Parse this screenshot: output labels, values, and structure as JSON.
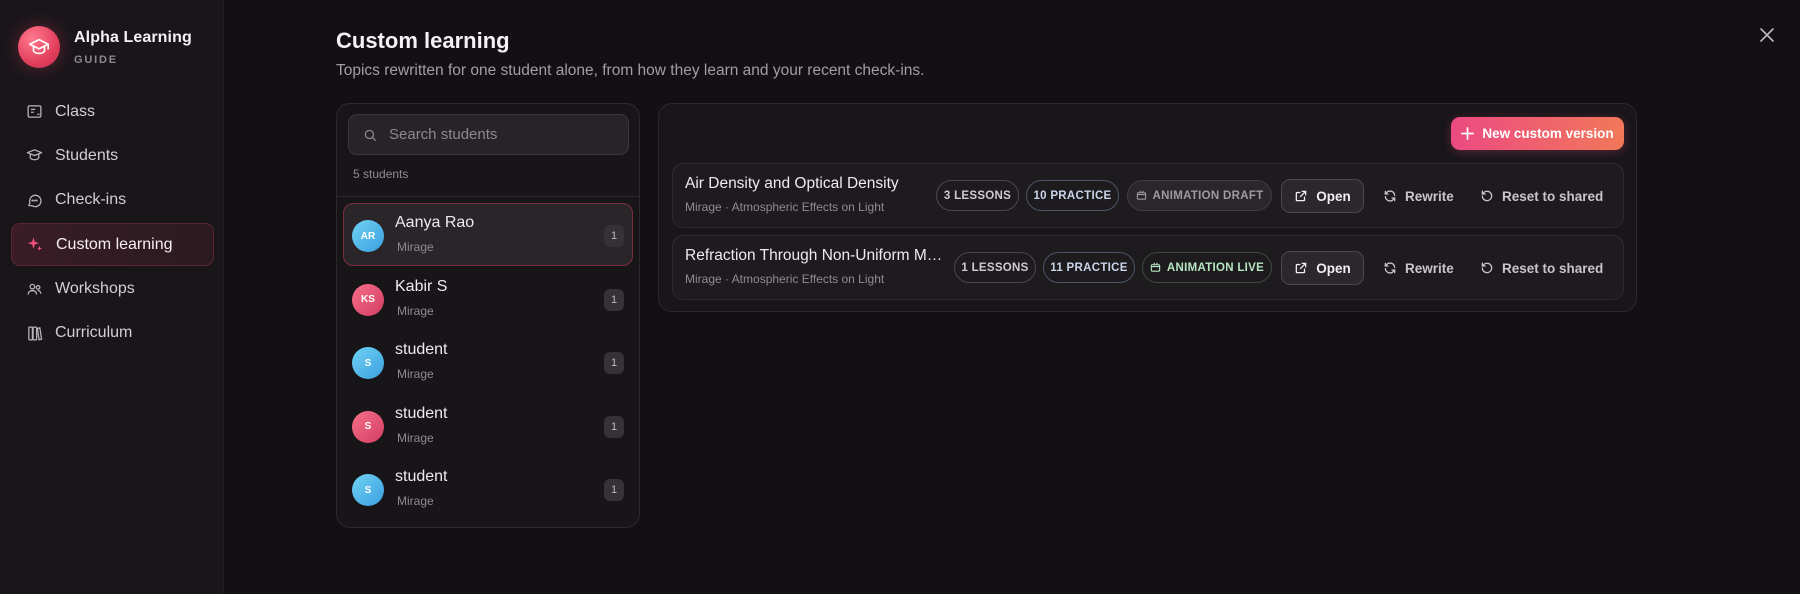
{
  "brand": {
    "title": "Alpha Learning",
    "subtitle": "GUIDE"
  },
  "nav": [
    {
      "label": "Class",
      "icon": "class-icon",
      "active": false
    },
    {
      "label": "Students",
      "icon": "students-icon",
      "active": false
    },
    {
      "label": "Check-ins",
      "icon": "chat-icon",
      "active": false
    },
    {
      "label": "Custom learning",
      "icon": "sparkle-icon",
      "active": true
    },
    {
      "label": "Workshops",
      "icon": "people-icon",
      "active": false
    },
    {
      "label": "Curriculum",
      "icon": "books-icon",
      "active": false
    }
  ],
  "header": {
    "title": "Custom learning",
    "subtitle": "Topics rewritten for one student alone, from how they learn and your recent check-ins."
  },
  "search": {
    "placeholder": "Search students"
  },
  "students_count": "5 students",
  "students": [
    {
      "initials": "AR",
      "name": "Aanya Rao",
      "group": "Mirage",
      "count": "1",
      "color": "blue",
      "active": true
    },
    {
      "initials": "KS",
      "name": "Kabir S",
      "group": "Mirage",
      "count": "1",
      "color": "pink",
      "active": false
    },
    {
      "initials": "S",
      "name": "student",
      "group": "Mirage",
      "count": "1",
      "color": "blue",
      "active": false
    },
    {
      "initials": "S",
      "name": "student",
      "group": "Mirage",
      "count": "1",
      "color": "pink",
      "active": false
    },
    {
      "initials": "S",
      "name": "student",
      "group": "Mirage",
      "count": "1",
      "color": "blue",
      "active": false
    }
  ],
  "new_button": "New custom version",
  "topics": [
    {
      "title": "Air Density and Optical Density",
      "subtitle": "Mirage · Atmospheric Effects on Light",
      "lessons": "3 LESSONS",
      "practice": "10 PRACTICE",
      "animation": "ANIMATION DRAFT",
      "open": "Open",
      "rewrite": "Rewrite",
      "reset": "Reset to shared"
    },
    {
      "title": "Refraction Through Non-Uniform Media",
      "subtitle": "Mirage · Atmospheric Effects on Light",
      "lessons": "1 LESSONS",
      "practice": "11 PRACTICE",
      "animation": "ANIMATION LIVE",
      "open": "Open",
      "rewrite": "Rewrite",
      "reset": "Reset to shared"
    }
  ],
  "colors": {
    "accent": "#ec4a82",
    "accent_end": "#f17859",
    "background": "#121013"
  }
}
